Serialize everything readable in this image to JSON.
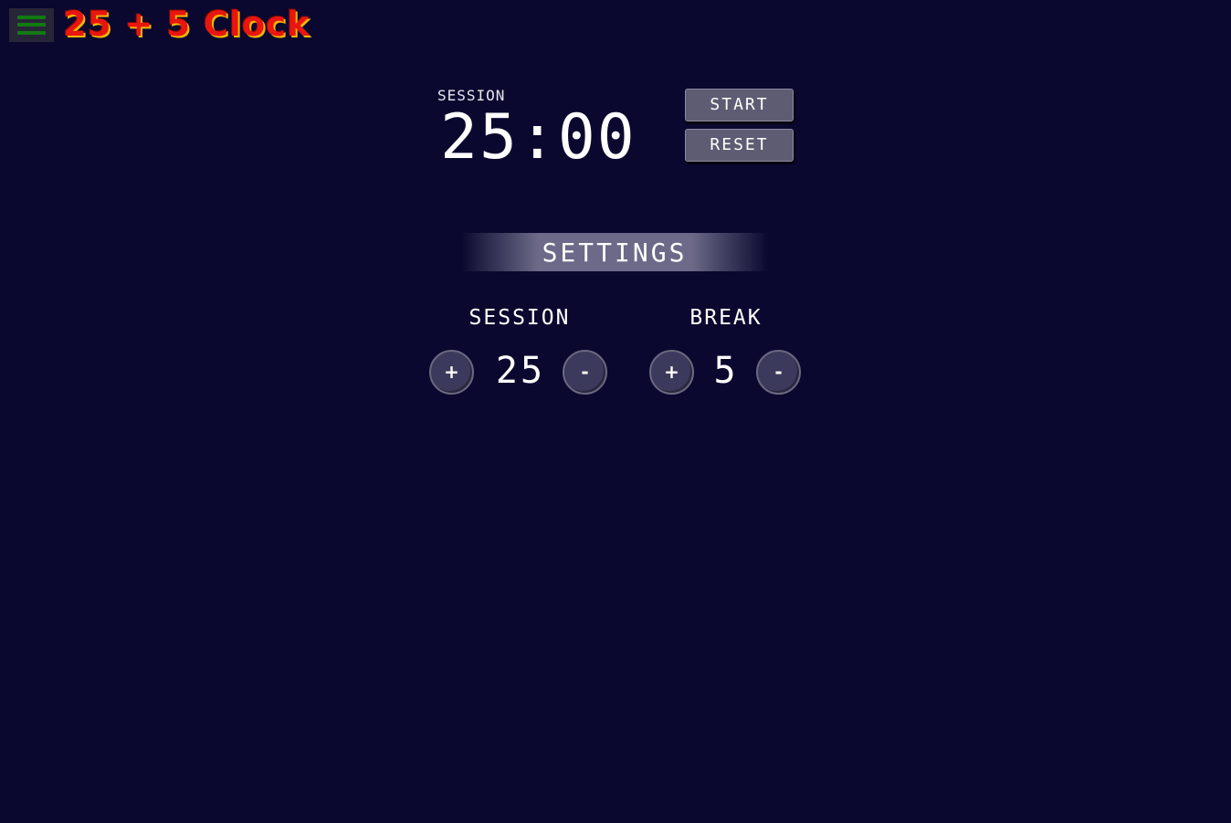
{
  "header": {
    "app_title": "25 + 5 Clock",
    "menu_icon": "hamburger-menu-icon"
  },
  "timer": {
    "label": "SESSION",
    "display": "25:00",
    "start_label": "START",
    "reset_label": "RESET"
  },
  "settings": {
    "title": "SETTINGS",
    "session": {
      "label": "SESSION",
      "value": "25",
      "increment_label": "+",
      "decrement_label": "-"
    },
    "break": {
      "label": "BREAK",
      "value": "5",
      "increment_label": "+",
      "decrement_label": "-"
    }
  },
  "colors": {
    "background": "#0a082e",
    "title_red": "#e8160e",
    "title_shadow": "#f5b800",
    "menu_bar_green": "#127a12",
    "button_gray": "#5e5c72",
    "round_button": "#3c3a5c"
  }
}
